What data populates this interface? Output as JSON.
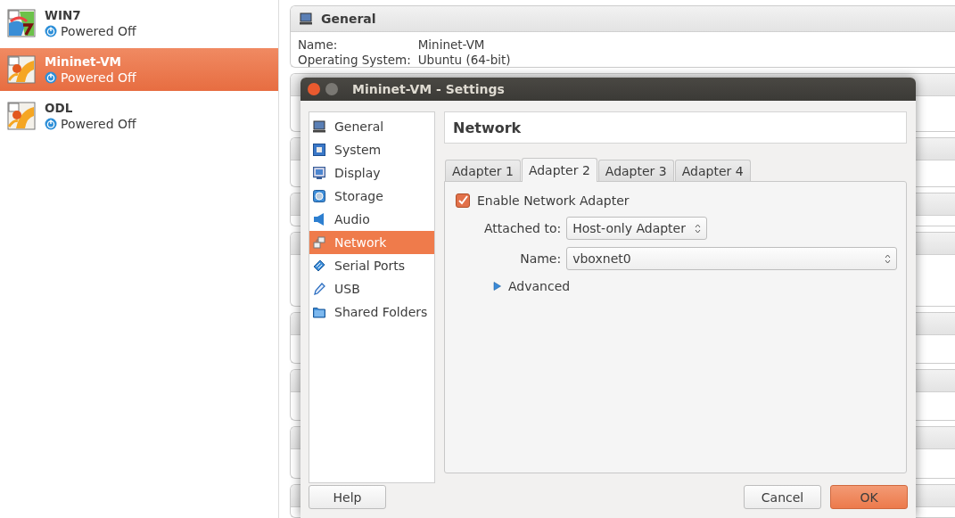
{
  "vm_list": [
    {
      "name": "WIN7",
      "status": "Powered Off",
      "kind": "windows",
      "selected": false
    },
    {
      "name": "Mininet-VM",
      "status": "Powered Off",
      "kind": "linux",
      "selected": true
    },
    {
      "name": "ODL",
      "status": "Powered Off",
      "kind": "linux",
      "selected": false
    }
  ],
  "details": {
    "general": {
      "title": "General",
      "rows": [
        {
          "label": "Name:",
          "value": "Mininet-VM"
        },
        {
          "label": "Operating System:",
          "value": "Ubuntu (64-bit)"
        }
      ]
    }
  },
  "dialog": {
    "title": "Mininet-VM - Settings",
    "sidebar": [
      {
        "label": "General",
        "kind": "general",
        "selected": false
      },
      {
        "label": "System",
        "kind": "system",
        "selected": false
      },
      {
        "label": "Display",
        "kind": "display",
        "selected": false
      },
      {
        "label": "Storage",
        "kind": "storage",
        "selected": false
      },
      {
        "label": "Audio",
        "kind": "audio",
        "selected": false
      },
      {
        "label": "Network",
        "kind": "network",
        "selected": true
      },
      {
        "label": "Serial Ports",
        "kind": "serial",
        "selected": false
      },
      {
        "label": "USB",
        "kind": "usb",
        "selected": false
      },
      {
        "label": "Shared Folders",
        "kind": "folder",
        "selected": false
      }
    ],
    "page_title": "Network",
    "tabs": [
      {
        "label": "Adapter 1",
        "selected": false
      },
      {
        "label": "Adapter 2",
        "selected": true
      },
      {
        "label": "Adapter 3",
        "selected": false
      },
      {
        "label": "Adapter 4",
        "selected": false
      }
    ],
    "enable_adapter": {
      "label": "Enable Network Adapter",
      "checked": true
    },
    "attached_to": {
      "label": "Attached to:",
      "value": "Host-only Adapter"
    },
    "adapter_name": {
      "label": "Name:",
      "value": "vboxnet0"
    },
    "advanced": {
      "label": "Advanced",
      "expanded": false
    },
    "buttons": [
      {
        "label": "Help",
        "default": false
      },
      {
        "label": "Cancel",
        "default": false
      },
      {
        "label": "OK",
        "default": true
      }
    ]
  }
}
